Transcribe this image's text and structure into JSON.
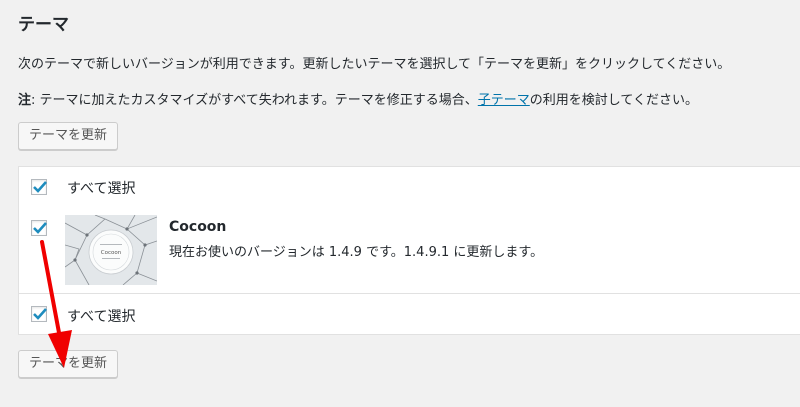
{
  "page": {
    "title": "テーマ",
    "description": "次のテーマで新しいバージョンが利用できます。更新したいテーマを選択して「テーマを更新」をクリックしてください。",
    "note_label": "注",
    "note_before": ": テーマに加えたカスタマイズがすべて失われます。テーマを修正する場合、",
    "note_link": "子テーマ",
    "note_after": "の利用を検討してください。"
  },
  "buttons": {
    "update_top": "テーマを更新",
    "update_bottom": "テーマを更新"
  },
  "table": {
    "select_all_top": "すべて選択",
    "select_all_bottom": "すべて選択",
    "theme": {
      "name": "Cocoon",
      "info": "現在お使いのバージョンは 1.4.9 です。1.4.9.1 に更新します。",
      "thumbnail_text": "Cocoon",
      "checked": true
    }
  },
  "colors": {
    "link": "#0073aa",
    "check": "#1e8cbe",
    "arrow": "#f00000"
  }
}
